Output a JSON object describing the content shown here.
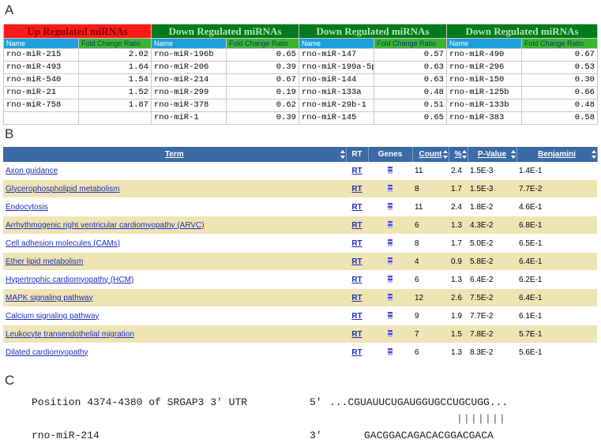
{
  "panels": {
    "a": "A",
    "b": "B",
    "c": "C"
  },
  "panelA": {
    "headers": [
      "Up Regulated miRNAs",
      "Down Regulated miRNAs",
      "Down Regulated miRNAs",
      "Down Regulated miRNAs"
    ],
    "sub_name": "Name",
    "sub_fc": "Fold Change Ratio",
    "rows": [
      [
        "rno-miR-215",
        "2.02",
        "rno-miR-196b",
        "0.65",
        "rno-miR-147",
        "0.57",
        "rno-miR-490",
        "0.67"
      ],
      [
        "rno-miR-493",
        "1.64",
        "rno-miR-206",
        "0.39",
        "rno-miR-199a-5p",
        "0.63",
        "rno-miR-296",
        "0.53"
      ],
      [
        "rno-miR-540",
        "1.54",
        "rno-miR-214",
        "0.67",
        "rno-miR-144",
        "0.63",
        "rno-miR-150",
        "0.30"
      ],
      [
        "rno-miR-21",
        "1.52",
        "rno-miR-299",
        "0.19",
        "rno-miR-133a",
        "0.48",
        "rno-miR-125b",
        "0.66"
      ],
      [
        "rno-miR-758",
        "1.87",
        "rno-miR-378",
        "0.62",
        "rno-miR-29b-1",
        "0.51",
        "rno-miR-133b",
        "0.48"
      ],
      [
        "",
        "",
        "rno-miR-1",
        "0.39",
        "rno-miR-145",
        "0.65",
        "rno-miR-383",
        "0.58"
      ]
    ],
    "colors": {
      "up": "#ff1a1a",
      "down": "#007a1a",
      "name": "#1ea0dc",
      "fc": "#3cb431"
    }
  },
  "panelB": {
    "columns": [
      "Term",
      "RT",
      "Genes",
      "Count",
      "%",
      "P-Value",
      "Benjamini"
    ],
    "rows": [
      [
        "Axon guidance",
        "RT",
        "11",
        "2.4",
        "1.5E-3",
        "1.4E-1"
      ],
      [
        "Glycerophospholipid metabolism",
        "RT",
        "8",
        "1.7",
        "1.5E-3",
        "7.7E-2"
      ],
      [
        "Endocytosis",
        "RT",
        "11",
        "2.4",
        "1.8E-2",
        "4.6E-1"
      ],
      [
        "Arrhythmogenic right ventricular cardiomyopathy (ARVC)",
        "RT",
        "6",
        "1.3",
        "4.3E-2",
        "6.8E-1"
      ],
      [
        "Cell adhesion molecules (CAMs)",
        "RT",
        "8",
        "1.7",
        "5.0E-2",
        "6.5E-1"
      ],
      [
        "Ether lipid metabolism",
        "RT",
        "4",
        "0.9",
        "5.8E-2",
        "6.4E-1"
      ],
      [
        "Hypertrophic cardiomyopathy (HCM)",
        "RT",
        "6",
        "1.3",
        "6.4E-2",
        "6.2E-1"
      ],
      [
        "MAPK signaling pathway",
        "RT",
        "12",
        "2.6",
        "7.5E-2",
        "6.4E-1"
      ],
      [
        "Calcium signaling pathway",
        "RT",
        "9",
        "1.9",
        "7.7E-2",
        "6.1E-1"
      ],
      [
        "Leukocyte transendothelial migration",
        "RT",
        "7",
        "1.5",
        "7.8E-2",
        "5.7E-1"
      ],
      [
        "Dilated cardiomyopathy",
        "RT",
        "6",
        "1.3",
        "8.3E-2",
        "5.6E-1"
      ]
    ],
    "colors": {
      "header": "#3b6aa5",
      "stripe": "#efe4b4",
      "link": "#1a2fb8"
    }
  },
  "panelC": {
    "target_label": "Position 4374-4380 of SRGAP3 3' UTR",
    "five_prime": "5'",
    "target_seq": "...CGUAUUCUGAUGGUGCCUGCUGG...",
    "pairing": "|||||||",
    "mirna_label": "rno-miR-214",
    "three_prime": "3'",
    "mirna_seq": "GACGGACAGACACGGACGACA"
  }
}
